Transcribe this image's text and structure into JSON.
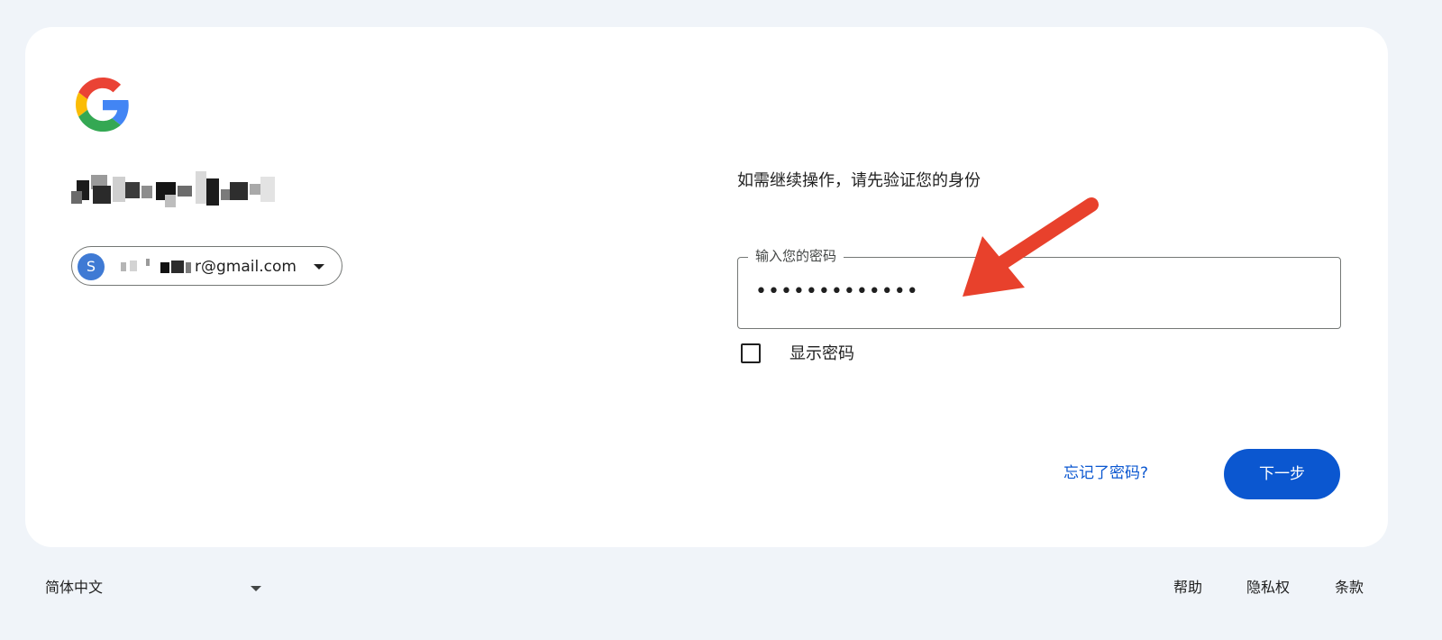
{
  "colors": {
    "page_background": "#f0f4f9",
    "card_background": "#ffffff",
    "primary_blue": "#0b57d0",
    "avatar_blue": "#3f7ad4",
    "annotation_arrow": "#e8412c",
    "google_blue": "#4285F4",
    "google_red": "#EA4335",
    "google_yellow": "#FBBC05",
    "google_green": "#34A853"
  },
  "logo": {
    "icon": "google-g-logo"
  },
  "account": {
    "avatar_letter": "S",
    "email_visible_part": "r@gmail.com",
    "email_redacted": true,
    "name_redacted": true,
    "dropdown_icon": "caret-down-icon"
  },
  "form": {
    "verify_message": "如需继续操作，请先验证您的身份",
    "password_label": "输入您的密码",
    "password_value": "•••••••••••••",
    "show_password_label": "显示密码",
    "show_password_checked": false,
    "forgot_link": "忘记了密码?",
    "next_button": "下一步"
  },
  "annotation": {
    "icon": "red-arrow-pointing-at-password-field"
  },
  "footer": {
    "language": "简体中文",
    "help": "帮助",
    "privacy": "隐私权",
    "terms": "条款"
  }
}
